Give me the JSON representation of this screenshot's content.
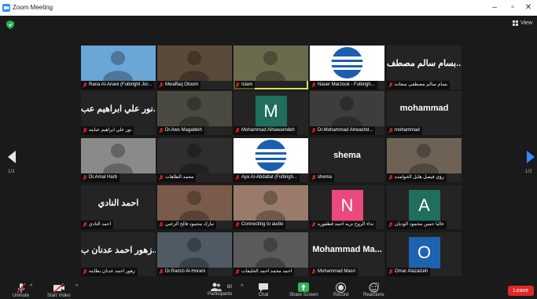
{
  "window": {
    "title": "Zoom Meeting"
  },
  "topbar": {
    "view_label": "View"
  },
  "pagination": {
    "left": "1/3",
    "right": "1/3"
  },
  "tiles": [
    {
      "name": "Rana Al-Anani (Fulbright Jor...",
      "big": "",
      "type": "photo",
      "bg": "#6aa6d6"
    },
    {
      "name": "Mwaffaq Otoom",
      "big": "",
      "type": "photo",
      "bg": "#5a4a3a"
    },
    {
      "name": "Islam",
      "big": "",
      "type": "photo",
      "bg": "#6b6a4d",
      "active": true
    },
    {
      "name": "Naser Marzouk - Fulbrigh...",
      "big": "",
      "type": "logo",
      "bg": "#ffffff"
    },
    {
      "name": "بسام سالم مصطفى سعاده",
      "big": "بسام سالم مصطف...",
      "type": "text",
      "bg": "#242424"
    },
    {
      "name": "نور علي ابراهيم عبابنه",
      "big": "نور علي ابراهيم عب...",
      "type": "text",
      "bg": "#242424"
    },
    {
      "name": "Dr.Aws Magableh",
      "big": "",
      "type": "photo",
      "bg": "#4a4a40"
    },
    {
      "name": "Mohammad Alhawamdeh",
      "big": "",
      "type": "letter",
      "letter": "M",
      "bg": "#1f6e5e"
    },
    {
      "name": "Dr.Mohammad Alrwashd...",
      "big": "",
      "type": "photo",
      "bg": "#3d3d3d"
    },
    {
      "name": "mohammad",
      "big": "mohammad",
      "type": "text",
      "bg": "#242424"
    },
    {
      "name": "Dr.Amal Harb",
      "big": "",
      "type": "photo",
      "bg": "#8a8a88"
    },
    {
      "name": "محمد الطاهات",
      "big": "",
      "type": "photo",
      "bg": "#2e2e2e"
    },
    {
      "name": "Aya Al-Abdallat (Fulbrigh...",
      "big": "",
      "type": "logo",
      "bg": "#ffffff"
    },
    {
      "name": "shema",
      "big": "shema",
      "type": "text",
      "bg": "#242424"
    },
    {
      "name": "رؤى فيصل هايل الخوامده",
      "big": "",
      "type": "photo",
      "bg": "#6e6254"
    },
    {
      "name": "احمد النادي",
      "big": "احمد النادي",
      "type": "text",
      "bg": "#242424"
    },
    {
      "name": "تبارك محمود فالح الزعبي",
      "big": "",
      "type": "photo",
      "bg": "#7a5a4a"
    },
    {
      "name": "Connecting to audio",
      "big": "",
      "type": "photo",
      "bg": "#9a7a6a"
    },
    {
      "name": "نداء الروح نزيه احمد قطقوره",
      "big": "",
      "type": "letter",
      "letter": "N",
      "bg": "#e9497c"
    },
    {
      "name": "عاليا حسن محمود الوديان",
      "big": "",
      "type": "letter",
      "letter": "A",
      "bg": "#1f6e5e"
    },
    {
      "name": "زهور احمد عدنان بطاينه",
      "big": "زهور احمد عدنان ب...",
      "type": "text",
      "bg": "#242424"
    },
    {
      "name": "Dr.Ramzi Al-Horani",
      "big": "",
      "type": "photo",
      "bg": "#4f5a64"
    },
    {
      "name": "احمد محمد احمد الخليفات",
      "big": "",
      "type": "photo",
      "bg": "#5a5a5a"
    },
    {
      "name": "Mohammad Masri",
      "big": "Mohammad Ma...",
      "type": "text",
      "bg": "#242424"
    },
    {
      "name": "Omar Alazaizeh",
      "big": "",
      "type": "letter",
      "letter": "O",
      "bg": "#1e63b0"
    }
  ],
  "toolbar": {
    "unmute": "Unmute",
    "start_video": "Start Video",
    "participants": "Participants",
    "participants_count": "80",
    "chat": "Chat",
    "share_screen": "Share Screen",
    "record": "Record",
    "reactions": "Reactions",
    "leave": "Leave"
  },
  "colors": {
    "active_border": "#cde25a",
    "mute_red": "#e02828",
    "share_green": "#2fb552",
    "zoom_blue": "#2d8cff"
  }
}
